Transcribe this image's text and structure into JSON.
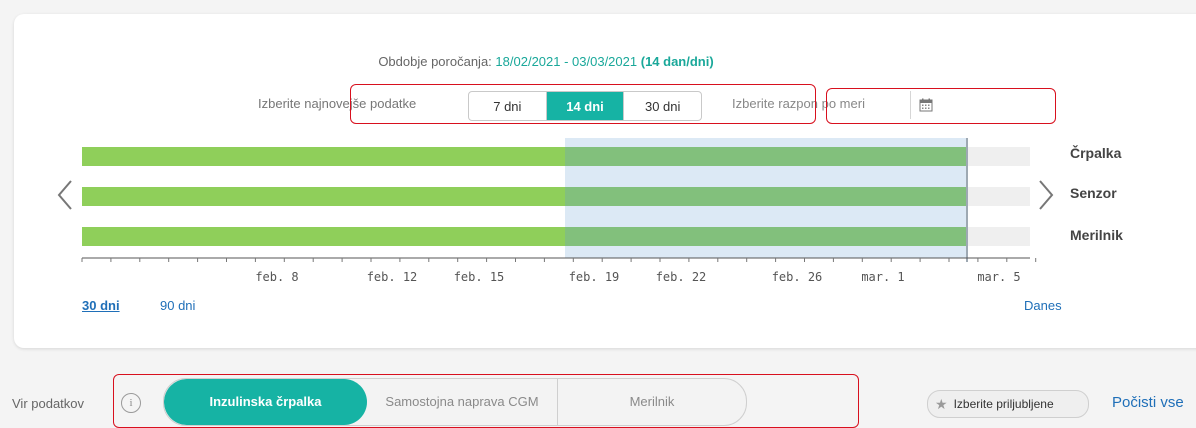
{
  "header": {
    "period_label": "Obdobje poročanja:",
    "period_dates": "18/02/2021 - 03/03/2021",
    "period_count": "(14 dan/dni)"
  },
  "range_selector": {
    "recent_label": "Izberite najnovejše podatke",
    "options": [
      "7 dni",
      "14 dni",
      "30 dni"
    ],
    "selected": "14 dni",
    "custom_label": "Izberite razpon po meri",
    "custom_value": ""
  },
  "timeline": {
    "rows": [
      "Črpalka",
      "Senzor",
      "Merilnik"
    ],
    "tick_labels": [
      "feb. 8",
      "feb. 12",
      "feb. 15",
      "feb. 19",
      "feb. 22",
      "feb. 26",
      "mar. 1",
      "mar. 5"
    ],
    "colors": {
      "data": "#8fcf5a",
      "data_selected": "#82c07c",
      "selection": "#dce9f5",
      "empty": "#efefef"
    }
  },
  "footer_links": {
    "days_30": "30 dni",
    "days_90": "90 dni",
    "today": "Danes"
  },
  "data_source": {
    "label": "Vir podatkov",
    "info_icon": "i",
    "options": [
      "Inzulinska črpalka",
      "Samostojna naprava CGM",
      "Merilnik"
    ],
    "selected": "Inzulinska črpalka"
  },
  "favorites_button": "Izberite priljubljene",
  "clear_link": "Počisti vse",
  "accent_color": "#16b3a4",
  "highlight_color": "#d8101e"
}
